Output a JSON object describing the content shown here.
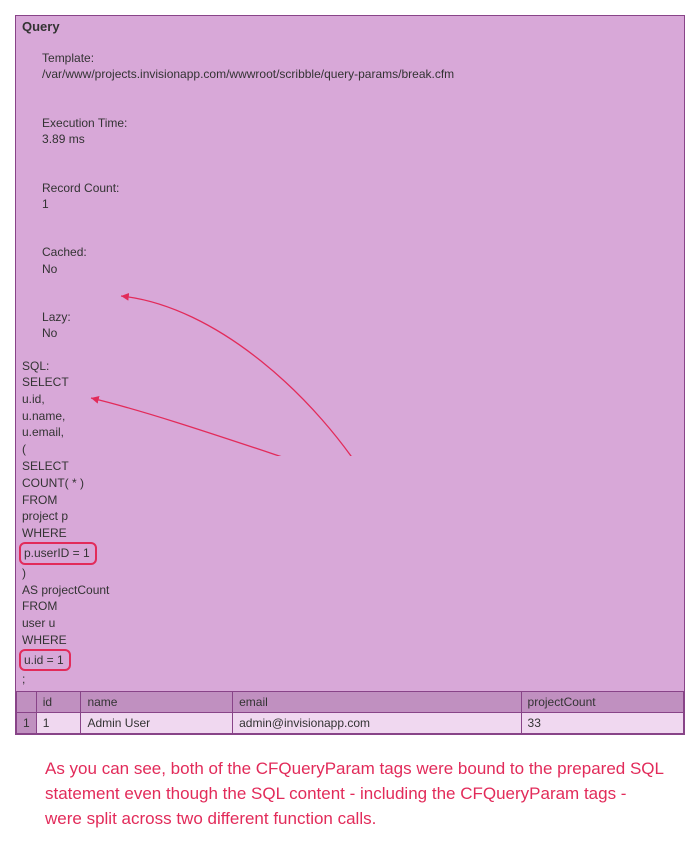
{
  "panel": {
    "title": "Query",
    "meta": {
      "template_label": "Template:",
      "template_value": "/var/www/projects.invisionapp.com/wwwroot/scribble/query-params/break.cfm",
      "exec_label": "Execution Time:",
      "exec_value": "3.89 ms",
      "count_label": "Record Count:",
      "count_value": "1",
      "cached_label": "Cached:",
      "cached_value": "No",
      "lazy_label": "Lazy:",
      "lazy_value": "No",
      "sql_label": "SQL:"
    },
    "sql": {
      "l1": "SELECT",
      "l2": "u.id,",
      "l3": "u.name,",
      "l4": "u.email,",
      "l5": "(",
      "l6": "SELECT",
      "l7": "COUNT( * )",
      "l8": "FROM",
      "l9": "project p",
      "l10": "WHERE",
      "l11_boxed": "p.userID = 1",
      "l12": ")",
      "l13": "AS projectCount",
      "l14": "FROM",
      "l15": "user u",
      "l16": "WHERE",
      "l17_boxed": "u.id = 1",
      "l18": ";"
    }
  },
  "table": {
    "headers": {
      "c0": "",
      "c1": "id",
      "c2": "name",
      "c3": "email",
      "c4": "projectCount"
    },
    "row1": {
      "n": "1",
      "id": "1",
      "name": "Admin User",
      "email": "admin@invisionapp.com",
      "pc": "33"
    }
  },
  "annotation": {
    "text": "As you can see, both of the CFQueryParam tags were bound to the prepared SQL statement even though the SQL content - including the CFQueryParam tags - were split across two different function calls."
  },
  "arrows": {
    "a1_indicator": "←",
    "a2_indicator": "←"
  },
  "colors": {
    "accent": "#e22b5a",
    "panel_bg": "#d8a8d8",
    "panel_border": "#884488"
  }
}
